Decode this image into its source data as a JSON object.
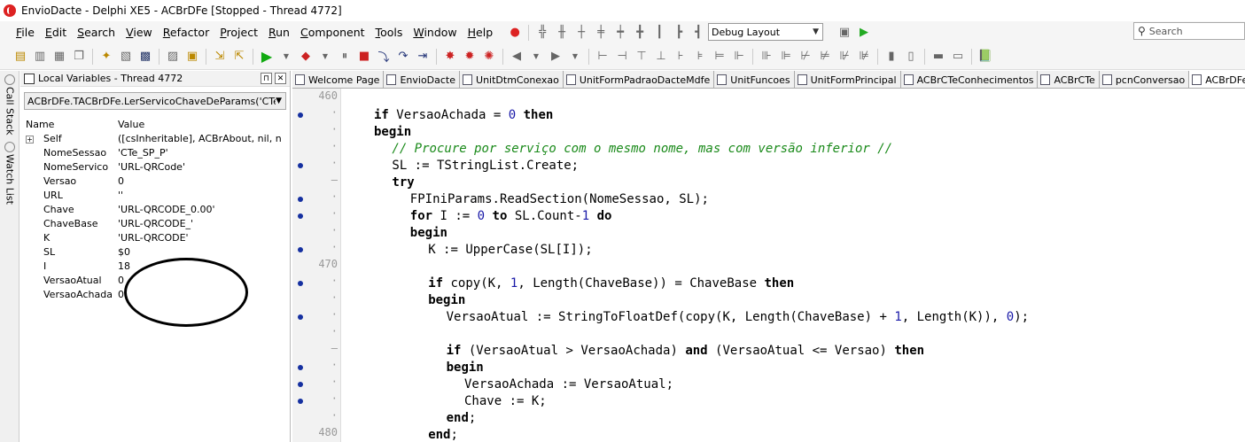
{
  "window": {
    "title": "EnvioDacte - Delphi XE5 - ACBrDFe [Stopped - Thread 4772]"
  },
  "menu": [
    {
      "label": "File",
      "accel": "F",
      "rest": "ile"
    },
    {
      "label": "Edit",
      "accel": "E",
      "rest": "dit"
    },
    {
      "label": "Search",
      "accel": "S",
      "rest": "earch"
    },
    {
      "label": "View",
      "accel": "V",
      "rest": "iew"
    },
    {
      "label": "Refactor",
      "accel": "R",
      "rest": "efactor"
    },
    {
      "label": "Project",
      "accel": "P",
      "rest": "roject"
    },
    {
      "label": "Run",
      "accel": "R",
      "rest": "un"
    },
    {
      "label": "Component",
      "accel": "C",
      "rest": "omponent"
    },
    {
      "label": "Tools",
      "accel": "T",
      "rest": "ools"
    },
    {
      "label": "Window",
      "accel": "W",
      "rest": "indow"
    },
    {
      "label": "Help",
      "accel": "H",
      "rest": "elp"
    }
  ],
  "layout_select": {
    "value": "Debug Layout"
  },
  "search": {
    "placeholder": "Search"
  },
  "side_tabs": {
    "call_stack": "Call Stack",
    "watch_list": "Watch List"
  },
  "local_vars": {
    "title": "Local Variables - Thread 4772",
    "context": "ACBrDFe.TACBrDFe.LerServicoChaveDeParams('CTe_SP",
    "col_name": "Name",
    "col_value": "Value",
    "rows": [
      {
        "name": "Self",
        "value": "([csInheritable], ACBrAbout, nil, nil...",
        "expandable": true
      },
      {
        "name": "NomeSessao",
        "value": "'CTe_SP_P'"
      },
      {
        "name": "NomeServico",
        "value": "'URL-QRCode'"
      },
      {
        "name": "Versao",
        "value": "0"
      },
      {
        "name": "URL",
        "value": "''"
      },
      {
        "name": "Chave",
        "value": "'URL-QRCODE_0.00'"
      },
      {
        "name": "ChaveBase",
        "value": "'URL-QRCODE_'"
      },
      {
        "name": "K",
        "value": "'URL-QRCODE'"
      },
      {
        "name": "SL",
        "value": "$0"
      },
      {
        "name": "I",
        "value": "18"
      },
      {
        "name": "VersaoAtual",
        "value": "0"
      },
      {
        "name": "VersaoAchada",
        "value": "0"
      }
    ]
  },
  "editor_tabs": [
    {
      "label": "Welcome Page"
    },
    {
      "label": "EnvioDacte"
    },
    {
      "label": "UnitDtmConexao"
    },
    {
      "label": "UnitFormPadraoDacteMdfe"
    },
    {
      "label": "UnitFuncoes"
    },
    {
      "label": "UnitFormPrincipal"
    },
    {
      "label": "ACBrCTeConhecimentos"
    },
    {
      "label": "ACBrCTe"
    },
    {
      "label": "pcnConversao"
    },
    {
      "label": "ACBrDFe",
      "active": true
    }
  ],
  "gutter": {
    "line_460": "460",
    "line_470": "470",
    "line_480": "480"
  },
  "code": [
    {
      "indent": 0,
      "tokens": [
        [
          "",
          ""
        ]
      ]
    },
    {
      "indent": 2,
      "tokens": [
        [
          "kw",
          "if"
        ],
        [
          "",
          " VersaoAchada = "
        ],
        [
          "numv",
          "0"
        ],
        [
          "",
          " "
        ],
        [
          "kw",
          "then"
        ]
      ]
    },
    {
      "indent": 2,
      "tokens": [
        [
          "kw",
          "begin"
        ]
      ]
    },
    {
      "indent": 3,
      "tokens": [
        [
          "cmt",
          "// Procure por serviço com o mesmo nome, mas com versão inferior //"
        ]
      ]
    },
    {
      "indent": 3,
      "tokens": [
        [
          "",
          "SL := TStringList.Create;"
        ]
      ]
    },
    {
      "indent": 3,
      "tokens": [
        [
          "kw",
          "try"
        ]
      ]
    },
    {
      "indent": 4,
      "tokens": [
        [
          "",
          "FPIniParams.ReadSection(NomeSessao, SL);"
        ]
      ]
    },
    {
      "indent": 4,
      "tokens": [
        [
          "kw",
          "for"
        ],
        [
          "",
          " I := "
        ],
        [
          "numv",
          "0"
        ],
        [
          "",
          " "
        ],
        [
          "kw",
          "to"
        ],
        [
          "",
          " SL.Count-"
        ],
        [
          "numv",
          "1"
        ],
        [
          "",
          " "
        ],
        [
          "kw",
          "do"
        ]
      ]
    },
    {
      "indent": 4,
      "tokens": [
        [
          "kw",
          "begin"
        ]
      ]
    },
    {
      "indent": 5,
      "tokens": [
        [
          "",
          "K := UpperCase(SL[I]);"
        ]
      ]
    },
    {
      "indent": 0,
      "tokens": [
        [
          "",
          ""
        ]
      ]
    },
    {
      "indent": 5,
      "tokens": [
        [
          "kw",
          "if"
        ],
        [
          "",
          " copy(K, "
        ],
        [
          "numv",
          "1"
        ],
        [
          "",
          ", Length(ChaveBase)) = ChaveBase "
        ],
        [
          "kw",
          "then"
        ]
      ]
    },
    {
      "indent": 5,
      "tokens": [
        [
          "kw",
          "begin"
        ]
      ]
    },
    {
      "indent": 6,
      "tokens": [
        [
          "",
          "VersaoAtual := StringToFloatDef(copy(K, Length(ChaveBase) + "
        ],
        [
          "numv",
          "1"
        ],
        [
          "",
          ", Length(K)), "
        ],
        [
          "numv",
          "0"
        ],
        [
          "",
          ");"
        ]
      ]
    },
    {
      "indent": 0,
      "tokens": [
        [
          "",
          ""
        ]
      ]
    },
    {
      "indent": 6,
      "tokens": [
        [
          "kw",
          "if"
        ],
        [
          "",
          " (VersaoAtual > VersaoAchada) "
        ],
        [
          "kw",
          "and"
        ],
        [
          "",
          " (VersaoAtual <= Versao) "
        ],
        [
          "kw",
          "then"
        ]
      ]
    },
    {
      "indent": 6,
      "tokens": [
        [
          "kw",
          "begin"
        ]
      ]
    },
    {
      "indent": 7,
      "tokens": [
        [
          "",
          "VersaoAchada := VersaoAtual;"
        ]
      ]
    },
    {
      "indent": 7,
      "tokens": [
        [
          "",
          "Chave := K;"
        ]
      ]
    },
    {
      "indent": 6,
      "tokens": [
        [
          "kw",
          "end"
        ],
        [
          "",
          ";"
        ]
      ]
    },
    {
      "indent": 5,
      "tokens": [
        [
          "kw",
          "end"
        ],
        [
          "",
          ";"
        ]
      ]
    }
  ]
}
